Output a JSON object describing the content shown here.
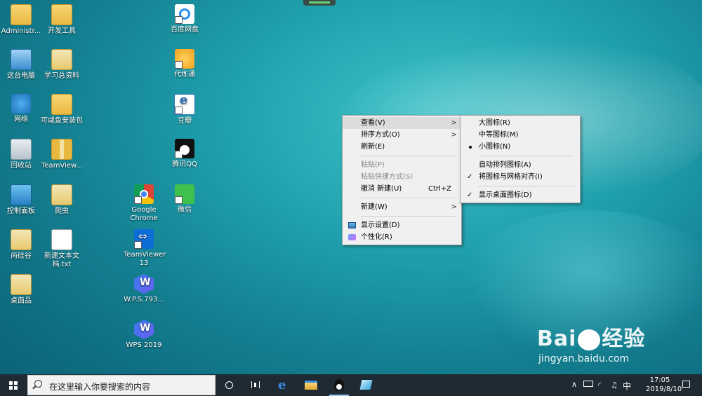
{
  "desktop": {
    "icons": [
      {
        "label": "Administr...",
        "icon": "user-folder-icon"
      },
      {
        "label": "开发工具",
        "icon": "folder-icon"
      },
      {
        "label": "百度网盘",
        "icon": "baidu-netdisk-icon"
      },
      {
        "label": "这台电脑",
        "icon": "this-pc-icon"
      },
      {
        "label": "学习总资料",
        "icon": "doc-folder-icon"
      },
      {
        "label": "代练通",
        "icon": "dailiantong-icon"
      },
      {
        "label": "网络",
        "icon": "network-icon"
      },
      {
        "label": "可咸鱼安装包",
        "icon": "folder-icon"
      },
      {
        "label": "豆瓣",
        "icon": "douban-icon"
      },
      {
        "label": "回收站",
        "icon": "recycle-bin-icon"
      },
      {
        "label": "TeamView...",
        "icon": "zip-folder-icon"
      },
      {
        "label": "腾讯QQ",
        "icon": "qq-icon"
      },
      {
        "label": "控制面板",
        "icon": "control-panel-icon"
      },
      {
        "label": "爬虫",
        "icon": "doc-folder-icon"
      },
      {
        "label": "Google Chrome",
        "icon": "chrome-icon"
      },
      {
        "label": "微信",
        "icon": "wechat-icon"
      },
      {
        "label": "尚硅谷",
        "icon": "doc-folder-icon"
      },
      {
        "label": "新建文本文档.txt",
        "icon": "text-file-icon"
      },
      {
        "label": "TeamViewer 13",
        "icon": "teamviewer-icon"
      },
      {
        "label": "桌面品",
        "icon": "doc-folder-icon"
      },
      {
        "label": "W.P.S.793...",
        "icon": "wps-icon"
      },
      {
        "label": "WPS 2019",
        "icon": "wps-icon"
      }
    ]
  },
  "context_menu": {
    "items": [
      {
        "label": "查看(V)",
        "submenu": true,
        "hover": true
      },
      {
        "label": "排序方式(O)",
        "submenu": true
      },
      {
        "label": "刷新(E)"
      },
      {
        "separator": true
      },
      {
        "label": "粘贴(P)",
        "disabled": true
      },
      {
        "label": "粘贴快捷方式(S)",
        "disabled": true
      },
      {
        "label": "撤消 新建(U)",
        "shortcut": "Ctrl+Z"
      },
      {
        "separator": true
      },
      {
        "label": "新建(W)",
        "submenu": true
      },
      {
        "separator": true
      },
      {
        "label": "显示设置(D)",
        "icon": "display-settings-icon"
      },
      {
        "label": "个性化(R)",
        "icon": "personalize-icon"
      }
    ]
  },
  "view_submenu": {
    "items": [
      {
        "label": "大图标(R)"
      },
      {
        "label": "中等图标(M)"
      },
      {
        "label": "小图标(N)",
        "bullet": true
      },
      {
        "separator": true
      },
      {
        "label": "自动排列图标(A)"
      },
      {
        "label": "将图标与网格对齐(I)",
        "check": true
      },
      {
        "separator": true
      },
      {
        "label": "显示桌面图标(D)",
        "check": true
      }
    ]
  },
  "taskbar": {
    "search_placeholder": "在这里输入你要搜索的内容",
    "ime": "中",
    "time": "17:05",
    "date": "2019/8/10"
  },
  "watermark": {
    "brand": "Bai",
    "brand2": "经验",
    "url": "jingyan.baidu.com"
  }
}
